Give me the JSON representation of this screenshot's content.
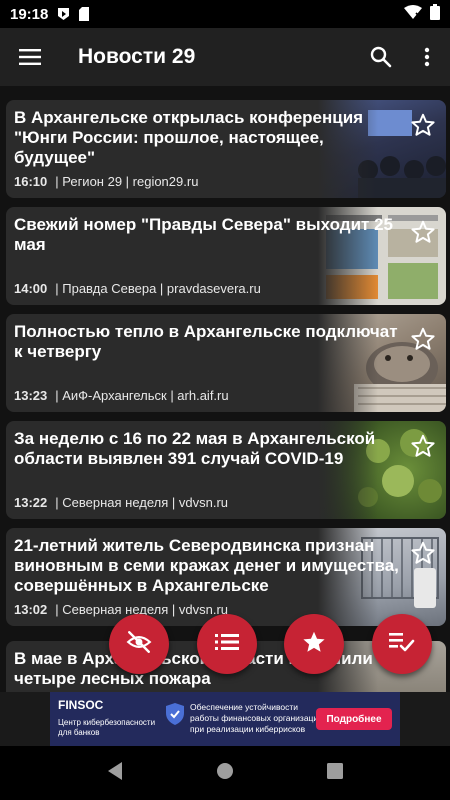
{
  "status_bar": {
    "time": "19:18",
    "icons": [
      "play-protect-icon",
      "sd-card-icon",
      "wifi-icon",
      "battery-icon"
    ]
  },
  "app_bar": {
    "title": "Новости 29",
    "icons": [
      "menu-icon",
      "search-icon",
      "more-vert-icon"
    ]
  },
  "news": [
    {
      "headline": "В Архангельске открылась конференция \"Юнги России: прошлое, настоящее, будущее\"",
      "time": "16:10",
      "source": "| Регион 29 | region29.ru",
      "starred": false
    },
    {
      "headline": "Свежий номер \"Правды Севера\" выходит 25 мая",
      "time": "14:00",
      "source": "| Правда Севера | pravdasevera.ru",
      "starred": false
    },
    {
      "headline": "Полностью тепло в Архангельске подключат к четвергу",
      "time": "13:23",
      "source": "| АиФ-Архангельск | arh.aif.ru",
      "starred": false
    },
    {
      "headline": "За неделю с 16 по 22 мая в Архангельской области выявлен 391 случай COVID-19",
      "time": "13:22",
      "source": "| Северная неделя | vdvsn.ru",
      "starred": false
    },
    {
      "headline": "21-летний житель Северодвинска признан виновным в семи кражах денег и имущества, совершённых в Архангельске",
      "time": "13:02",
      "source": "| Северная неделя | vdvsn.ru",
      "starred": false
    },
    {
      "headline": "В мае в Архангельской области потушили четыре лесных пожара",
      "time": "",
      "source": "",
      "starred": false
    }
  ],
  "fabs": [
    "hide-read-icon",
    "list-icon",
    "star-icon",
    "playlist-check-icon"
  ],
  "ad": {
    "brand": "FINSOC",
    "brand_sub": "Центр кибербезопасности для банков",
    "text": "Обеспечение устойчивости работы финансовых организаций при реализации киберрисков",
    "button": "Подробнее"
  },
  "nav_bar": {
    "icons": [
      "back-icon",
      "home-icon",
      "recents-icon"
    ]
  },
  "colors": {
    "background": "#121212",
    "card": "#2b2b2b",
    "app_bar": "#212121",
    "fab": "#c62334",
    "ad_background": "#232a5c",
    "ad_button": "#e3234f"
  }
}
